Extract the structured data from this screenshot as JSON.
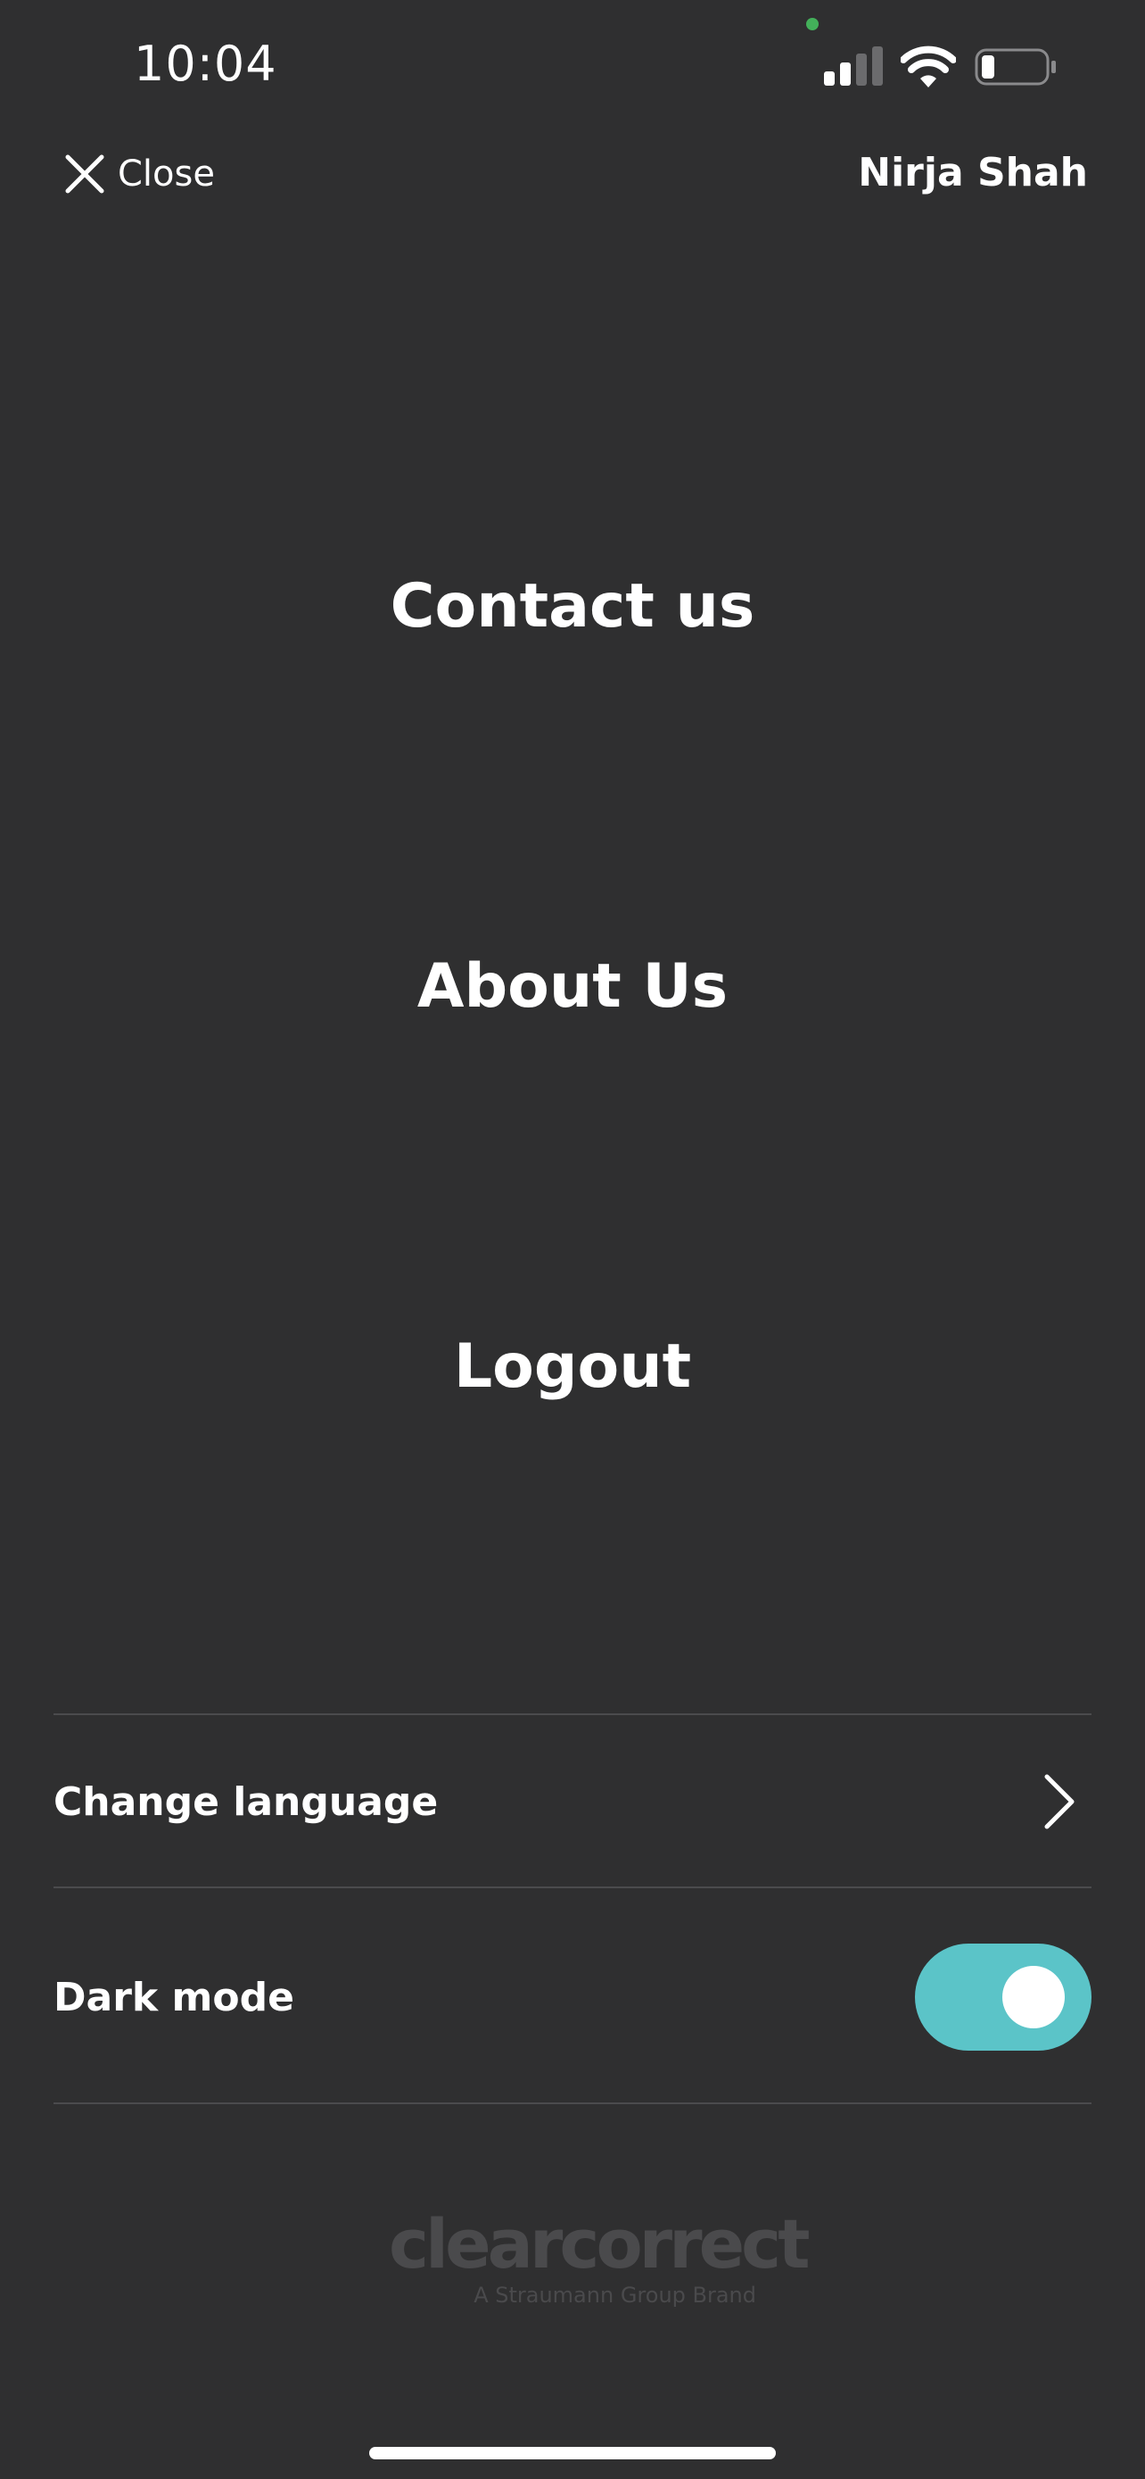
{
  "status_bar": {
    "time": "10:04",
    "signal_bars_active": 2,
    "battery_level": 0.2
  },
  "header": {
    "close_label": "Close",
    "user_name": "Nirja Shah"
  },
  "menu": {
    "items": [
      {
        "label": "Contact us"
      },
      {
        "label": "About Us"
      },
      {
        "label": "Logout"
      }
    ]
  },
  "settings": {
    "change_language_label": "Change language",
    "dark_mode_label": "Dark mode",
    "dark_mode_enabled": true
  },
  "brand": {
    "name": "clearcorrect",
    "tagline": "A Straumann Group Brand"
  },
  "colors": {
    "background": "#2f2f30",
    "text": "#ffffff",
    "toggle_on": "#5bc4c8",
    "divider": "#4b4b4d",
    "logo": "#4a4a4c",
    "camera_indicator": "#43b05a"
  },
  "icons": {
    "close": "close-icon",
    "chevron": "chevron-right-icon",
    "signal": "cellular-signal-icon",
    "wifi": "wifi-icon",
    "battery": "battery-icon"
  }
}
